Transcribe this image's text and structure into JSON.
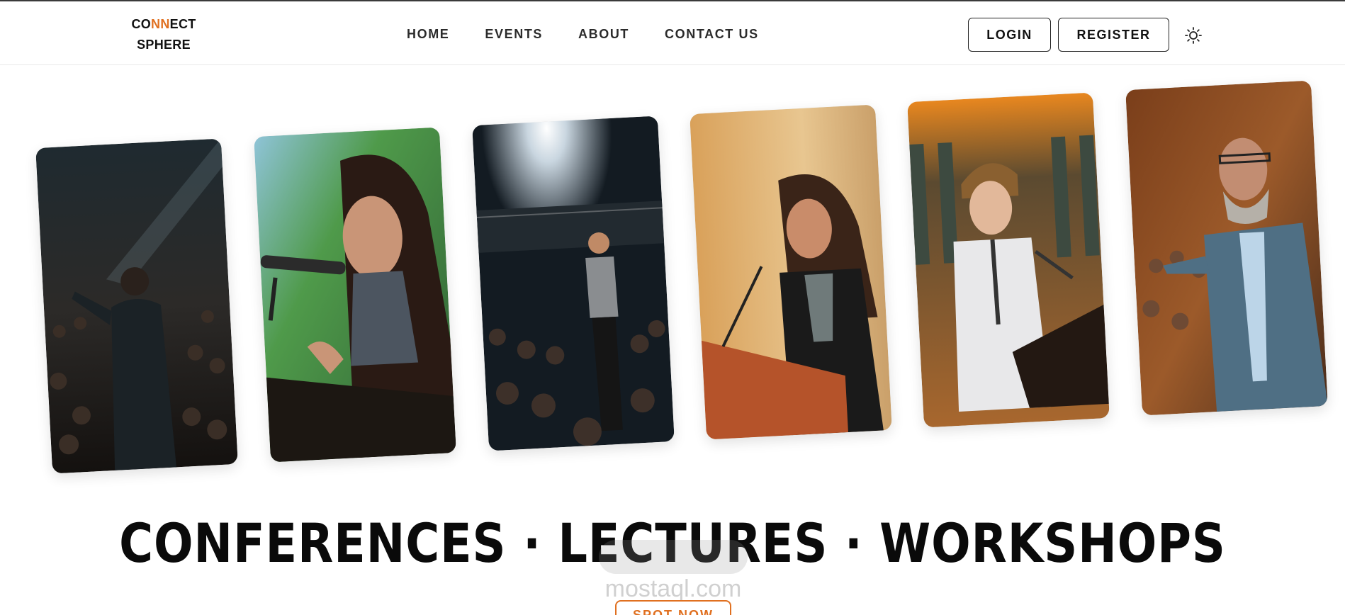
{
  "header": {
    "logo_part1": "CO",
    "logo_accent": "NN",
    "logo_part2": "ECT",
    "logo_line2": "SPHERE",
    "nav": [
      "HOME",
      "EVENTS",
      "ABOUT",
      "CONTACT US"
    ],
    "login_label": "LOGIN",
    "register_label": "REGISTER",
    "theme_icon": "sun-icon"
  },
  "gallery": {
    "images": [
      "speaker-on-dark-stage-photo",
      "woman-speaking-at-microphone-photo",
      "speaker-under-spotlight-photo",
      "woman-at-podium-photo",
      "student-at-podium-photo",
      "man-presenting-in-auditorium-photo"
    ]
  },
  "hero": {
    "headline": "CONFERENCES · LECTURES · WORKSHOPS",
    "cta_label": "SPOT NOW"
  },
  "watermark": {
    "text": "mostaql.com"
  },
  "colors": {
    "accent": "#e07020",
    "text": "#111111",
    "border": "#222222"
  }
}
